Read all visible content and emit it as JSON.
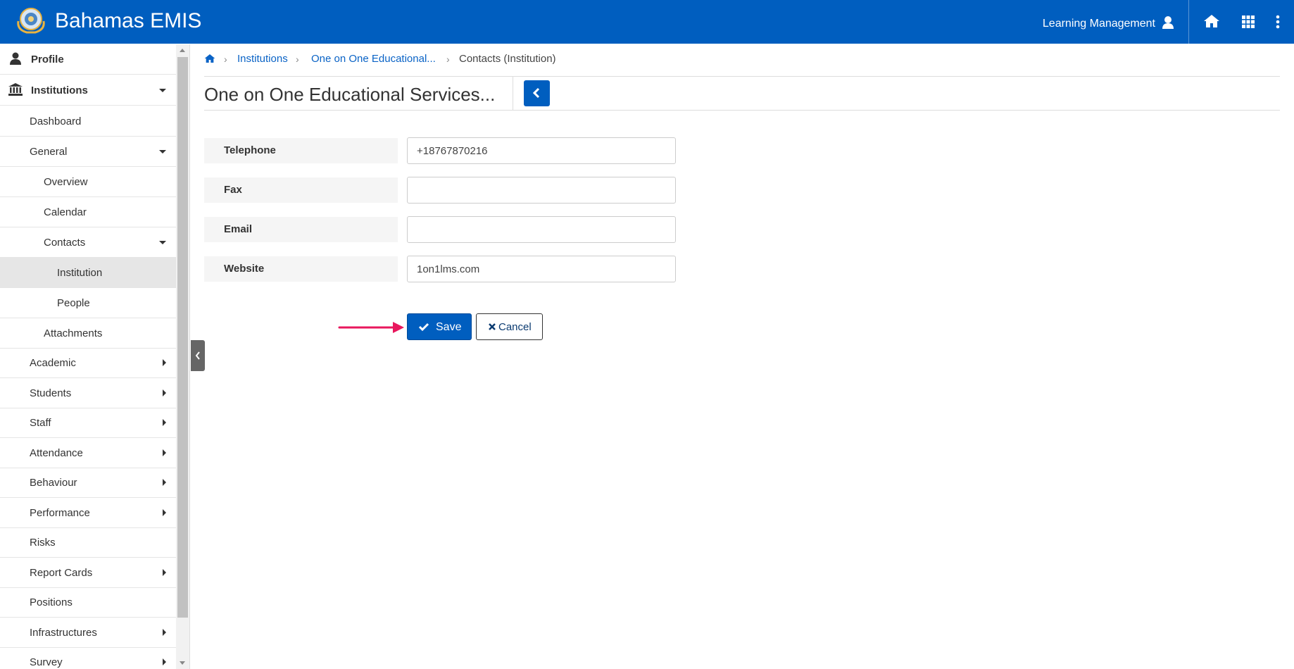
{
  "header": {
    "app_title": "Bahamas EMIS",
    "user_label": "Learning Management",
    "brand_color": "#005ebf"
  },
  "sidebar": {
    "items": [
      {
        "label": "Profile",
        "icon": "user-icon"
      },
      {
        "label": "Institutions",
        "icon": "bank-icon"
      },
      {
        "label": "Dashboard"
      },
      {
        "label": "General"
      },
      {
        "label": "Overview"
      },
      {
        "label": "Calendar"
      },
      {
        "label": "Contacts"
      },
      {
        "label": "Institution"
      },
      {
        "label": "People"
      },
      {
        "label": "Attachments"
      },
      {
        "label": "Academic"
      },
      {
        "label": "Students"
      },
      {
        "label": "Staff"
      },
      {
        "label": "Attendance"
      },
      {
        "label": "Behaviour"
      },
      {
        "label": "Performance"
      },
      {
        "label": "Risks"
      },
      {
        "label": "Report Cards"
      },
      {
        "label": "Positions"
      },
      {
        "label": "Infrastructures"
      },
      {
        "label": "Survey"
      }
    ]
  },
  "breadcrumb": {
    "items": [
      "Institutions",
      "One on One Educational...",
      "Contacts (Institution)"
    ]
  },
  "page": {
    "title": "One on One Educational Services..."
  },
  "form": {
    "fields": [
      {
        "label": "Telephone",
        "value": "+18767870216"
      },
      {
        "label": "Fax",
        "value": ""
      },
      {
        "label": "Email",
        "value": ""
      },
      {
        "label": "Website",
        "value": "1on1lms.com"
      }
    ],
    "save_label": "Save",
    "cancel_label": "Cancel"
  },
  "annotation": {
    "arrow_color": "#e8175d"
  }
}
